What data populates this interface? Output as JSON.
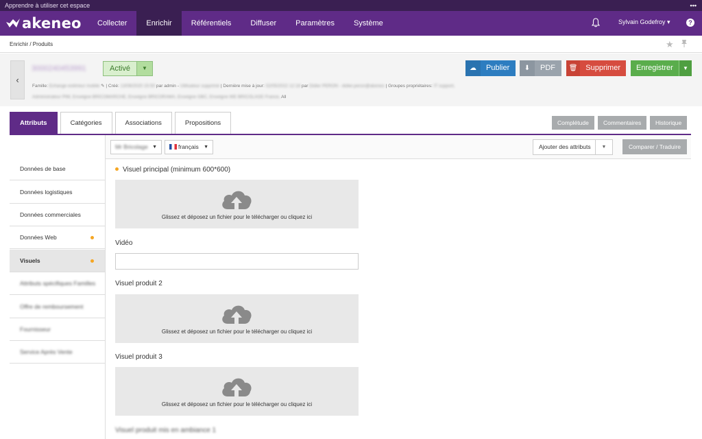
{
  "topbar": {
    "text": "Apprendre à utiliser cet espace",
    "menu_icon": "more-dots-icon"
  },
  "nav": {
    "logo": "akeneo",
    "items": [
      {
        "label": "Collecter",
        "active": false
      },
      {
        "label": "Enrichir",
        "active": true
      },
      {
        "label": "Référentiels",
        "active": false
      },
      {
        "label": "Diffuser",
        "active": false
      },
      {
        "label": "Paramètres",
        "active": false
      },
      {
        "label": "Système",
        "active": false
      }
    ],
    "user": "Sylvain Godefroy ▾",
    "help": "?",
    "colors": {
      "nav_bg": "#5f2b87",
      "active_bg": "#3a1f52"
    }
  },
  "breadcrumb": "Enrichir / Produits",
  "product": {
    "sku": "3000240453991",
    "status": "Activé",
    "meta_family_label": "Famille:",
    "meta_family_value": "Echange extérieur mobile",
    "meta_created_label": "| Créé:",
    "meta_created_value": "13/08/2020 15:50",
    "meta_by_admin": "par admin -",
    "meta_admin_value": "Utilisateur supprimé",
    "meta_updated_label": "| Dernière mise à jour:",
    "meta_updated_value": "02/05/2022 12:18",
    "meta_par": "par",
    "meta_updated_by": "Didier PERON - didier.peron@akeneo",
    "meta_groups_label": "| Groupes propriétaires:",
    "meta_groups_value": "IT support,",
    "meta2_blur": "Administrateur PIM, Enseigne BRICOMARCHE, Enseigne BRICORAMA, Enseigne GBC, Enseigne WE BRICOLAGE France,",
    "meta2_end": "All"
  },
  "actions": {
    "publish": "Publier",
    "pdf": "PDF",
    "delete": "Supprimer",
    "save": "Enregistrer"
  },
  "tabs": [
    "Attributs",
    "Catégories",
    "Associations",
    "Propositions"
  ],
  "right_tabs": [
    "Complétude",
    "Commentaires",
    "Historique"
  ],
  "toolbar": {
    "channel": "Mr Bricolage",
    "locale": "français",
    "add_attributes": "Ajouter des attributs",
    "compare": "Comparer / Traduire"
  },
  "sidebar": [
    {
      "label": "Données de base",
      "blurred": false,
      "dot": false,
      "active": false
    },
    {
      "label": "Données logistiques",
      "blurred": false,
      "dot": false,
      "active": false
    },
    {
      "label": "Données commerciales",
      "blurred": false,
      "dot": false,
      "active": false
    },
    {
      "label": "Données Web",
      "blurred": false,
      "dot": true,
      "active": false
    },
    {
      "label": "Visuels",
      "blurred": false,
      "dot": true,
      "active": true
    },
    {
      "label": "Attributs spécifiques Familles",
      "blurred": true,
      "dot": false,
      "active": false
    },
    {
      "label": "Offre de remboursement",
      "blurred": true,
      "dot": false,
      "active": false
    },
    {
      "label": "Fournisseur",
      "blurred": true,
      "dot": false,
      "active": false
    },
    {
      "label": "Service Après Vente",
      "blurred": true,
      "dot": false,
      "active": false
    }
  ],
  "fields": {
    "main_visual": "Visuel principal (minimum 600*600)",
    "upload_text": "Glissez et déposez un fichier pour le télécharger ou cliquez ici",
    "video": "Vidéo",
    "visual2": "Visuel produit 2",
    "visual3": "Visuel produit 3",
    "ambiance": "Visuel produit mis en ambiance 1"
  }
}
